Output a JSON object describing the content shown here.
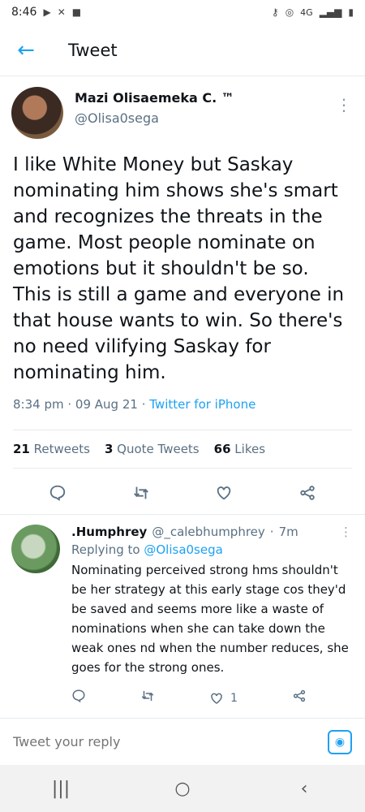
{
  "status_bar": {
    "time": "8:46",
    "left_icons": [
      "media-icon",
      "missed-call-icon",
      "vpn-icon"
    ],
    "right_text": "4G"
  },
  "header": {
    "title": "Tweet"
  },
  "tweet": {
    "author_name": "Mazi Olisaemeka C. ™",
    "author_handle": "@Olisa0sega",
    "text": "I like White Money but Saskay nominating him shows she's smart and recognizes the threats in the game. Most people nominate on emotions but it shouldn't be so. This is still a game and everyone in that house wants to win. So there's no need vilifying Saskay for nominating him.",
    "time": "8:34 pm",
    "date": "09 Aug 21",
    "source": "Twitter for iPhone",
    "retweets": "21",
    "retweets_label": "Retweets",
    "quotes": "3",
    "quotes_label": "Quote Tweets",
    "likes": "66",
    "likes_label": "Likes"
  },
  "reply": {
    "name": ".Humphrey",
    "handle": "@_calebhumphrey",
    "time": "7m",
    "replying_label": "Replying to",
    "replying_to": "@Olisa0sega",
    "text": "Nominating perceived strong hms shouldn't be her strategy at this early stage cos they'd be saved and seems more like a waste of nominations when she can take down the weak ones nd when the number reduces, she goes for the strong ones.",
    "likes": "1"
  },
  "compose": {
    "placeholder": "Tweet your reply"
  },
  "colors": {
    "accent": "#1da1f2",
    "secondary_text": "#5b7083"
  }
}
